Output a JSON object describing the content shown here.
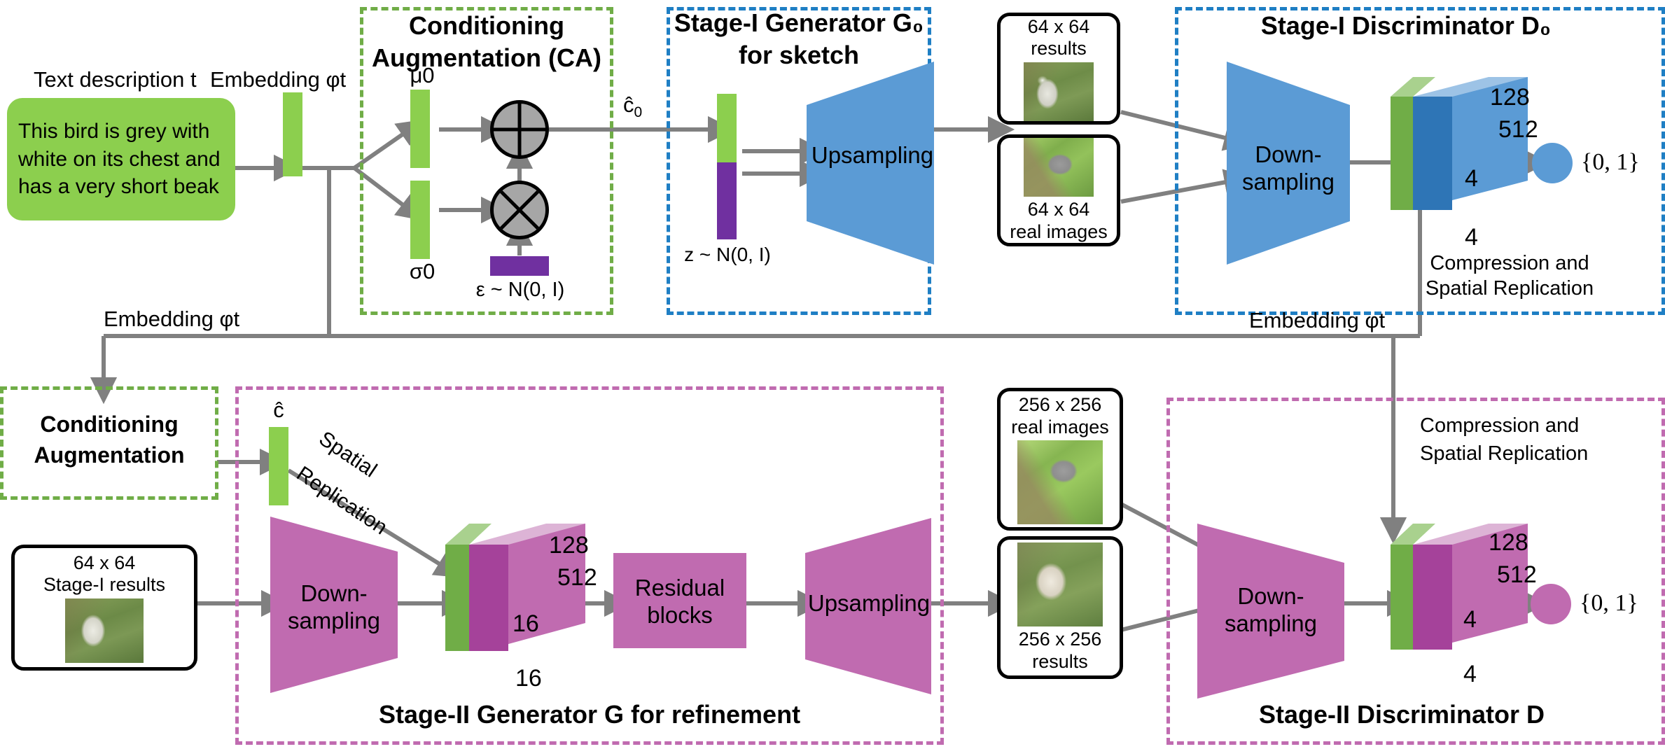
{
  "colors": {
    "green": "#8ccf4e",
    "green_dark": "#70ad47",
    "blue": "#5b9bd5",
    "blue_dark": "#1f7fc4",
    "pink": "#c06bb0",
    "purple": "#7030a0",
    "gray_wire": "#808080",
    "black": "#000000"
  },
  "stage1": {
    "ca_box": {
      "title_line1": "Conditioning",
      "title_line2": "Augmentation (CA)"
    },
    "text_description_label": "Text description t",
    "text_description": "This bird is grey with white on its chest and has a very short beak",
    "embedding_label": "Embedding φt",
    "mu_label": "μ0",
    "sigma_label": "σ0",
    "epsilon_label": "ε ~ N(0, I)",
    "chat0_label": "ĉ₀",
    "generator": {
      "title_line1": "Stage-I Generator G₀",
      "title_line2": "for sketch",
      "block": "Upsampling",
      "z_label": "z ~ N(0, I)"
    },
    "results_card": {
      "line1": "64 x 64",
      "line2": "results"
    },
    "real_card": {
      "line1": "64 x 64",
      "line2": "real images"
    },
    "discriminator": {
      "title": "Stage-I Discriminator D₀",
      "block_line1": "Down-",
      "block_line2": "sampling",
      "cube_depth": "128",
      "cube_channels": "512",
      "cube_h": "4",
      "cube_w": "4",
      "caption_line1": "Compression and",
      "caption_line2": "Spatial Replication",
      "output": "{0, 1}"
    }
  },
  "middle": {
    "embedding_left": "Embedding φt",
    "embedding_right": "Embedding φt"
  },
  "stage2": {
    "ca_box": {
      "title_line1": "Conditioning",
      "title_line2": "Augmentation"
    },
    "chat_label": "ĉ",
    "spatial_replication_line1": "Spatial",
    "spatial_replication_line2": "Replication",
    "input_card": {
      "line1": "64 x 64",
      "line2": "Stage-I results"
    },
    "generator": {
      "title": "Stage-II Generator G for refinement",
      "down_line1": "Down-",
      "down_line2": "sampling",
      "cube_depth": "128",
      "cube_channels": "512",
      "cube_h": "16",
      "cube_w": "16",
      "residual_line1": "Residual",
      "residual_line2": "blocks",
      "upsampling": "Upsampling"
    },
    "real_card": {
      "line1": "256 x 256",
      "line2": "real images"
    },
    "results_card": {
      "line1": "256 x 256",
      "line2": "results"
    },
    "discriminator": {
      "title": "Stage-II Discriminator D",
      "block_line1": "Down-",
      "block_line2": "sampling",
      "cube_depth": "128",
      "cube_channels": "512",
      "cube_h": "4",
      "cube_w": "4",
      "caption_line1": "Compression and",
      "caption_line2": "Spatial Replication",
      "output": "{0, 1}"
    }
  }
}
